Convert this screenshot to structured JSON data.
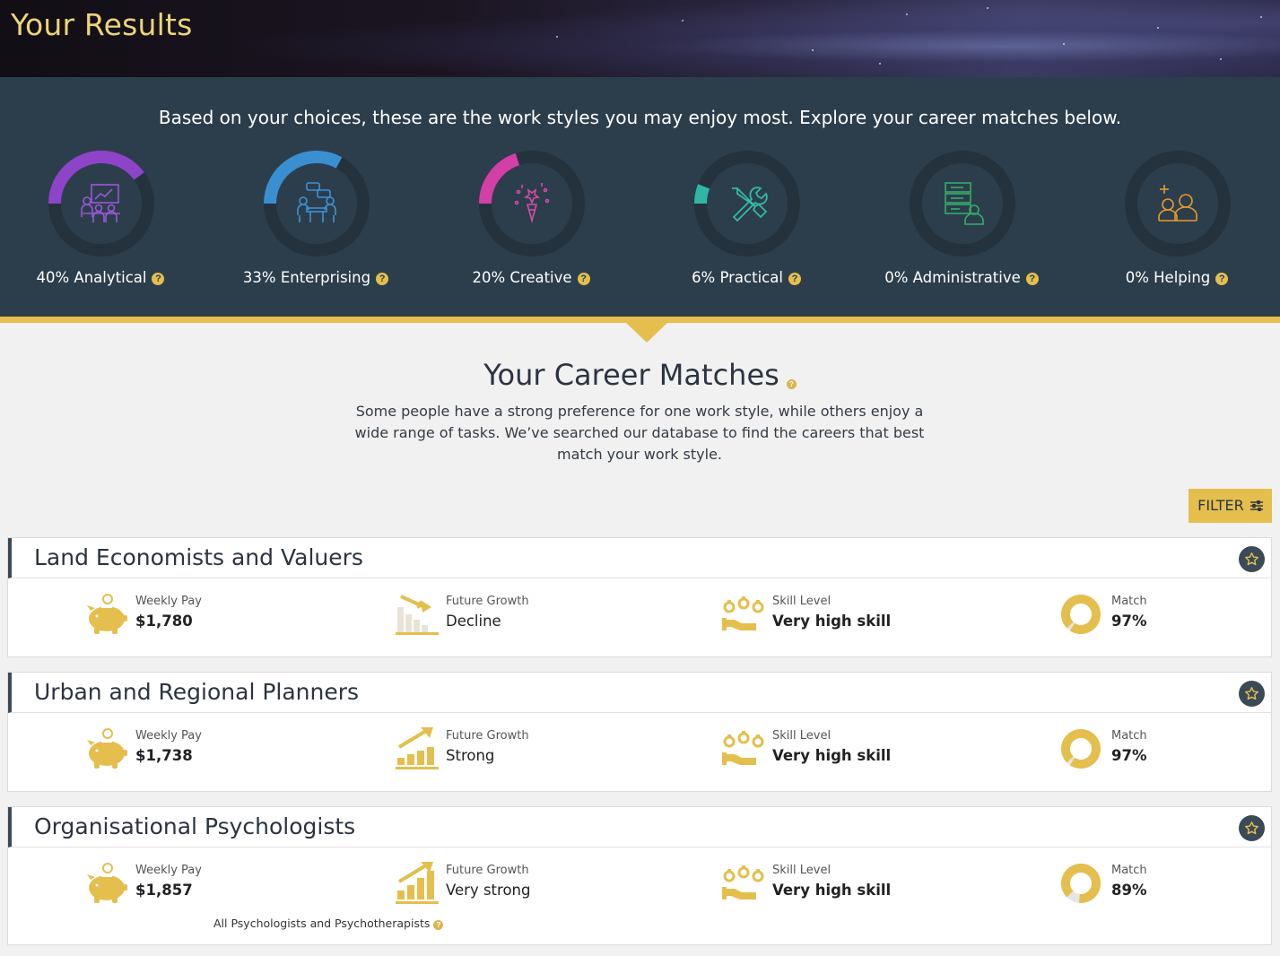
{
  "header": {
    "title": "Your Results"
  },
  "work_styles": {
    "intro": "Based on your choices, these are the work styles you may enjoy most. Explore your career matches below.",
    "items": [
      {
        "label": "40% Analytical",
        "percent": 40,
        "color": "#8e44c9",
        "icon": "analytical-icon"
      },
      {
        "label": "33% Enterprising",
        "percent": 33,
        "color": "#3a8fd1",
        "icon": "enterprising-icon"
      },
      {
        "label": "20% Creative",
        "percent": 20,
        "color": "#d23fa6",
        "icon": "creative-icon"
      },
      {
        "label": "6% Practical",
        "percent": 6,
        "color": "#2fb6a4",
        "icon": "practical-icon"
      },
      {
        "label": "0% Administrative",
        "percent": 0,
        "color": "#2faa66",
        "icon": "administrative-icon"
      },
      {
        "label": "0% Helping",
        "percent": 0,
        "color": "#e89b2c",
        "icon": "helping-icon"
      }
    ]
  },
  "matches": {
    "title": "Your Career Matches",
    "description": "Some people have a strong preference for one work style, while others enjoy a wide range of tasks. We’ve searched our database to find the careers that best match your work style.",
    "filter_label": "FILTER",
    "labels": {
      "pay": "Weekly Pay",
      "growth": "Future Growth",
      "skill": "Skill Level",
      "match": "Match"
    },
    "careers": [
      {
        "title": "Land Economists and Valuers",
        "pay": "$1,780",
        "growth": "Decline",
        "growth_trend": "down",
        "skill": "Very high skill",
        "match": "97%",
        "match_value": 97
      },
      {
        "title": "Urban and Regional Planners",
        "pay": "$1,738",
        "growth": "Strong",
        "growth_trend": "up",
        "skill": "Very high skill",
        "match": "97%",
        "match_value": 97
      },
      {
        "title": "Organisational Psychologists",
        "pay": "$1,857",
        "growth": "Very strong",
        "growth_trend": "up",
        "skill": "Very high skill",
        "match": "89%",
        "match_value": 89,
        "note": "All Psychologists and Psychotherapists"
      }
    ]
  },
  "colors": {
    "accent": "#e4bf4e",
    "panel": "#2c3e4c",
    "title_gold": "#ecd47a"
  }
}
